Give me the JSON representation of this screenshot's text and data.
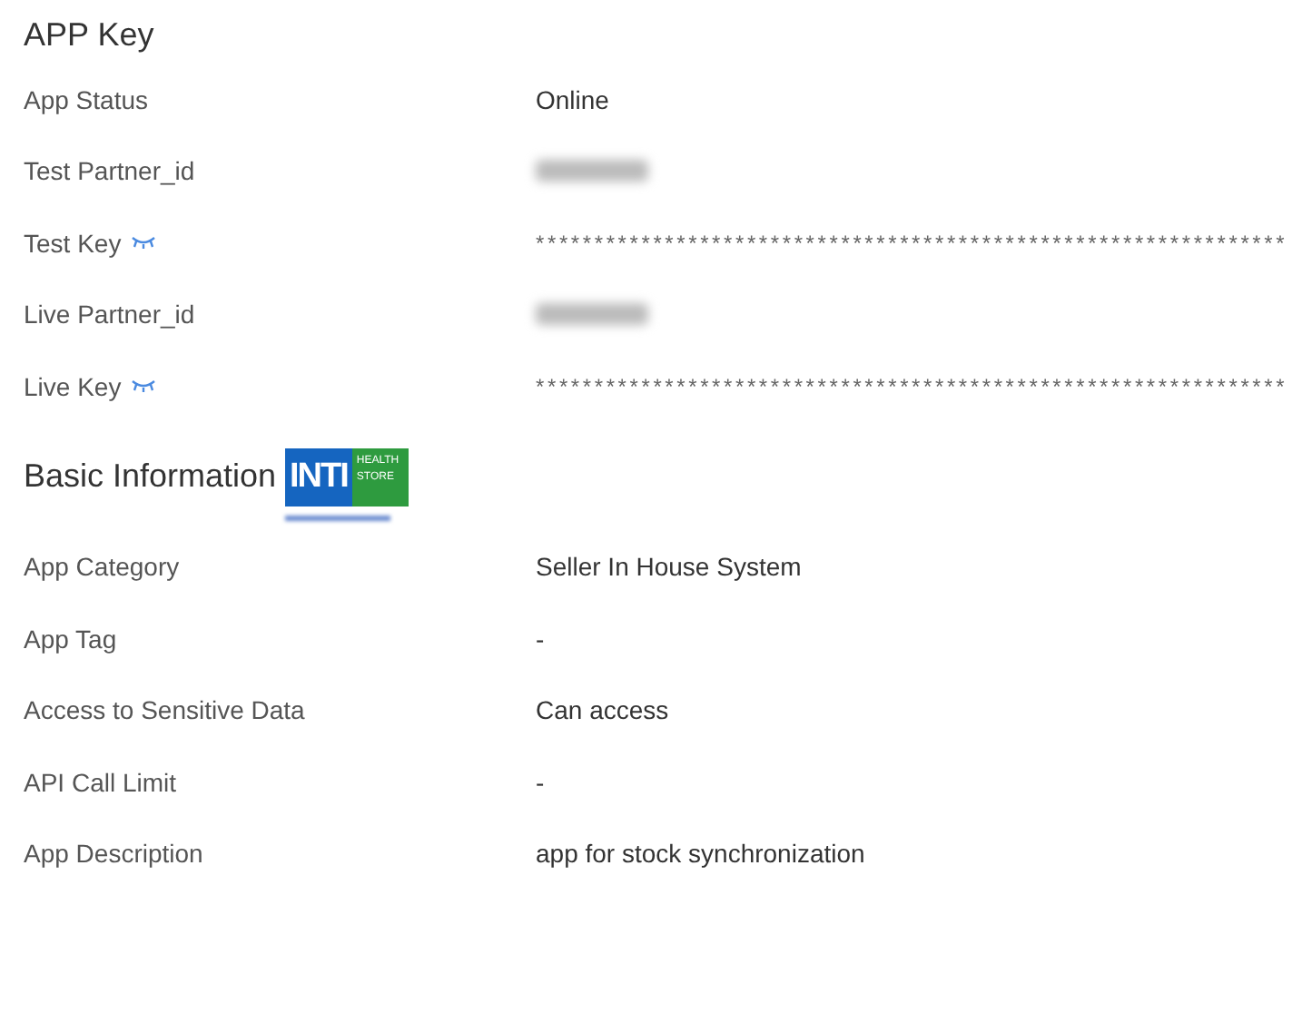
{
  "sections": [
    {
      "title": "APP Key",
      "rows": [
        {
          "kind": "text",
          "label": "App Status",
          "value": "Online"
        },
        {
          "kind": "redacted",
          "label": "Test Partner_id"
        },
        {
          "kind": "secret",
          "label": "Test Key",
          "value": "****************************************************************"
        },
        {
          "kind": "redacted",
          "label": "Live Partner_id"
        },
        {
          "kind": "secret",
          "label": "Live Key",
          "value": "****************************************************************"
        }
      ]
    },
    {
      "title": "Basic Information",
      "logo": {
        "main": "INTI",
        "side": "HEALTH STORE"
      },
      "rows": [
        {
          "kind": "text",
          "label": "App Category",
          "value": "Seller In House System"
        },
        {
          "kind": "text",
          "label": "App Tag",
          "value": "-"
        },
        {
          "kind": "text",
          "label": "Access to Sensitive Data",
          "value": "Can access"
        },
        {
          "kind": "text",
          "label": "API Call Limit",
          "value": "-"
        },
        {
          "kind": "text",
          "label": "App Description",
          "value": "app for stock synchronization"
        }
      ]
    }
  ]
}
